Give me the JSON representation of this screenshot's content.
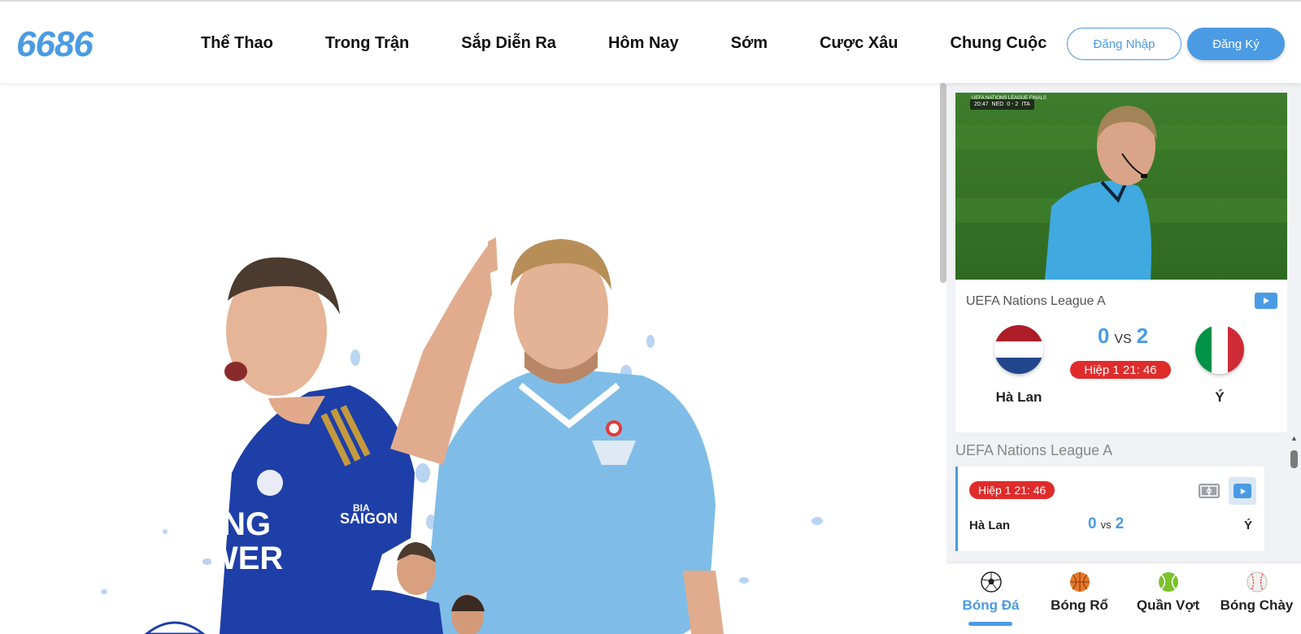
{
  "brand": {
    "logo": "6686",
    "accent": "#4a9be4",
    "live_red": "#e02b2b"
  },
  "nav": {
    "items": [
      "Thể Thao",
      "Trong Trận",
      "Sắp Diễn Ra",
      "Hôm Nay",
      "Sớm",
      "Cược Xâu",
      "Chung Cuộc"
    ],
    "login_label": "Đăng Nhập",
    "register_label": "Đăng Ký"
  },
  "hero": {
    "jersey_left": [
      "ING",
      "WER"
    ],
    "jersey_left_sponsor": [
      "BIA",
      "SAIGON"
    ]
  },
  "video": {
    "overlay_title": "UEFA NATIONS LEAGUE FINALS",
    "overlay_time": "20:47",
    "overlay_home": "NED",
    "overlay_score": "0 - 2",
    "overlay_away": "ITA"
  },
  "featured_match": {
    "league": "UEFA Nations League A",
    "home_team": "Hà Lan",
    "away_team": "Ý",
    "home_score": "0",
    "away_score": "2",
    "vs": "VS",
    "period": "Hiệp 1   21: 46"
  },
  "match_list": {
    "league": "UEFA Nations League A",
    "items": [
      {
        "period": "Hiệp 1   21: 46",
        "home_team": "Hà Lan",
        "away_team": "Ý",
        "home_score": "0",
        "away_score": "2",
        "vs": "vs"
      }
    ]
  },
  "sport_tabs": [
    {
      "label": "Bóng Đá",
      "icon": "soccer-ball-icon",
      "active": true
    },
    {
      "label": "Bóng Rổ",
      "icon": "basketball-icon",
      "active": false
    },
    {
      "label": "Quần Vợt",
      "icon": "tennis-ball-icon",
      "active": false
    },
    {
      "label": "Bóng Chày",
      "icon": "baseball-icon",
      "active": false
    }
  ]
}
